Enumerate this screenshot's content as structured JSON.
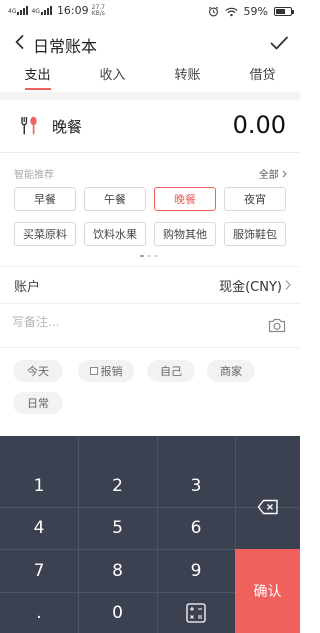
{
  "status_bar": {
    "signal_1": "4G",
    "signal_2": "4G",
    "time": "16:09",
    "speed_value": "27.7",
    "speed_unit": "KB/s",
    "battery": "59%"
  },
  "header": {
    "title": "日常账本"
  },
  "tabs": [
    {
      "label": "支出",
      "active": true
    },
    {
      "label": "收入"
    },
    {
      "label": "转账"
    },
    {
      "label": "借贷"
    }
  ],
  "entry": {
    "category": "晚餐",
    "amount": "0.00"
  },
  "recommend": {
    "title": "智能推荐",
    "all_label": "全部",
    "chips": [
      {
        "label": "早餐"
      },
      {
        "label": "午餐"
      },
      {
        "label": "晚餐",
        "active": true
      },
      {
        "label": "夜宵"
      },
      {
        "label": "买菜原料"
      },
      {
        "label": "饮料水果"
      },
      {
        "label": "购物其他"
      },
      {
        "label": "服饰鞋包"
      }
    ]
  },
  "account": {
    "label": "账户",
    "value": "现金(CNY)"
  },
  "note": {
    "placeholder": "写备注..."
  },
  "tags": [
    {
      "label": "今天"
    },
    {
      "label": "报销",
      "checkbox": true
    },
    {
      "label": "自己"
    },
    {
      "label": "商家"
    },
    {
      "label": "日常"
    }
  ],
  "keypad": {
    "keys": [
      "1",
      "2",
      "3",
      "4",
      "5",
      "6",
      "7",
      "8",
      "9",
      ".",
      "0"
    ],
    "confirm": "确认"
  },
  "colors": {
    "accent": "#f0605d",
    "keypad_bg": "#3b4150"
  }
}
